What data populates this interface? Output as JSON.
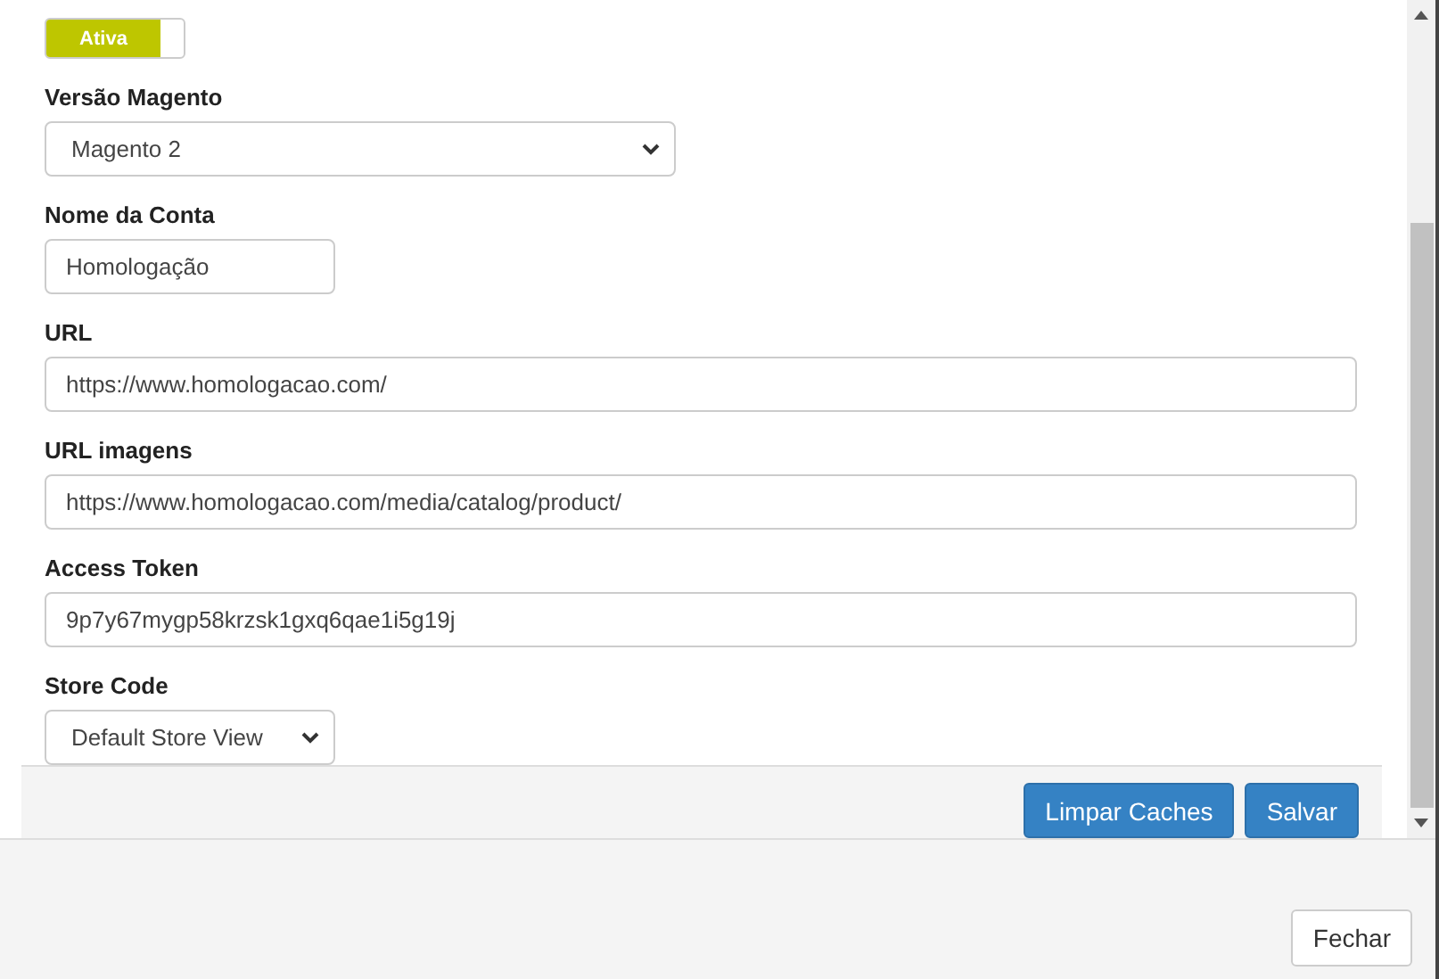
{
  "status_toggle": {
    "label": "Ativa",
    "on": true
  },
  "fields": [
    {
      "label": "Versão Magento",
      "kind": "select",
      "value": "Magento 2"
    },
    {
      "label": "Nome da Conta",
      "kind": "text",
      "value": "Homologação"
    },
    {
      "label": "URL",
      "kind": "text",
      "value": "https://www.homologacao.com/"
    },
    {
      "label": "URL imagens",
      "kind": "text",
      "value": "https://www.homologacao.com/media/catalog/product/"
    },
    {
      "label": "Access Token",
      "kind": "text",
      "value": "9p7y67mygp58krzsk1gxq6qae1i5g19j"
    },
    {
      "label": "Store Code",
      "kind": "select",
      "value": "Default Store View"
    }
  ],
  "actions": [
    "Limpar Caches",
    "Salvar"
  ],
  "footer_button": "Fechar"
}
